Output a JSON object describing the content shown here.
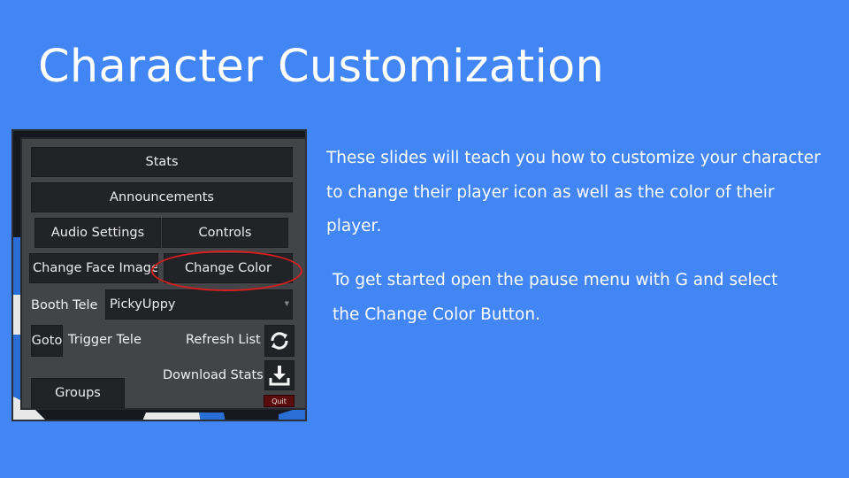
{
  "slide": {
    "title": "Character Customization",
    "paragraph_1": "These slides will teach you how to customize your character to change their player icon as well as the color of their player.",
    "paragraph_2": "To get started open the pause menu with G and select the Change Color Button."
  },
  "pause_menu": {
    "stats_label": "Stats",
    "announcements_label": "Announcements",
    "audio_settings_label": "Audio Settings",
    "controls_label": "Controls",
    "change_face_image_label": "Change Face Image",
    "change_color_label": "Change Color",
    "booth_tele_label": "Booth Tele",
    "booth_dropdown_value": "PickyUppy",
    "goto_label": "Goto",
    "trigger_tele_label": "Trigger Tele",
    "refresh_list_label": "Refresh List",
    "download_stats_label": "Download Stats",
    "groups_label": "Groups",
    "quit_label": "Quit",
    "icons": {
      "refresh": "refresh-icon",
      "download": "download-icon",
      "dropdown": "chevron-down-icon"
    }
  },
  "colors": {
    "background": "#4285f4",
    "highlight": "#d81f1f",
    "button": "#222327",
    "panel": "#434448",
    "quit": "#5a0c0c"
  }
}
